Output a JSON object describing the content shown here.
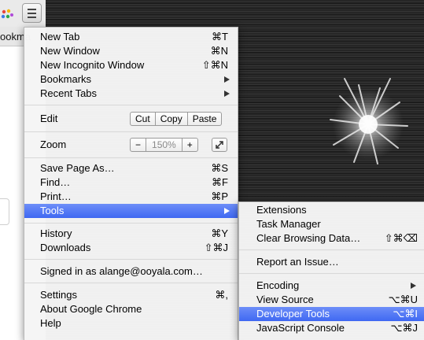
{
  "browser": {
    "bookmark_bar_text": "ookma",
    "menu_icon": "hamburger-menu-icon",
    "extension_icon": "colorful-dots-icon"
  },
  "main_menu": {
    "new_tab": {
      "label": "New Tab",
      "shortcut": "⌘T"
    },
    "new_window": {
      "label": "New Window",
      "shortcut": "⌘N"
    },
    "new_incognito": {
      "label": "New Incognito Window",
      "shortcut": "⇧⌘N"
    },
    "bookmarks": {
      "label": "Bookmarks"
    },
    "recent_tabs": {
      "label": "Recent Tabs"
    },
    "edit": {
      "label": "Edit",
      "cut": "Cut",
      "copy": "Copy",
      "paste": "Paste"
    },
    "zoom": {
      "label": "Zoom",
      "minus": "−",
      "value": "150%",
      "plus": "+"
    },
    "save_page": {
      "label": "Save Page As…",
      "shortcut": "⌘S"
    },
    "find": {
      "label": "Find…",
      "shortcut": "⌘F"
    },
    "print": {
      "label": "Print…",
      "shortcut": "⌘P"
    },
    "tools": {
      "label": "Tools"
    },
    "history": {
      "label": "History",
      "shortcut": "⌘Y"
    },
    "downloads": {
      "label": "Downloads",
      "shortcut": "⇧⌘J"
    },
    "signed_in": {
      "label": "Signed in as alange@ooyala.com…"
    },
    "settings": {
      "label": "Settings",
      "shortcut": "⌘,"
    },
    "about": {
      "label": "About Google Chrome"
    },
    "help": {
      "label": "Help"
    }
  },
  "tools_submenu": {
    "extensions": {
      "label": "Extensions"
    },
    "task_manager": {
      "label": "Task Manager"
    },
    "clear_data": {
      "label": "Clear Browsing Data…",
      "shortcut": "⇧⌘⌫"
    },
    "report_issue": {
      "label": "Report an Issue…"
    },
    "encoding": {
      "label": "Encoding"
    },
    "view_source": {
      "label": "View Source",
      "shortcut": "⌥⌘U"
    },
    "developer_tools": {
      "label": "Developer Tools",
      "shortcut": "⌥⌘I"
    },
    "js_console": {
      "label": "JavaScript Console",
      "shortcut": "⌥⌘J"
    }
  },
  "colors": {
    "highlight": "#4a72f4",
    "menu_bg": "#f5f5f5",
    "background": "#262626"
  }
}
